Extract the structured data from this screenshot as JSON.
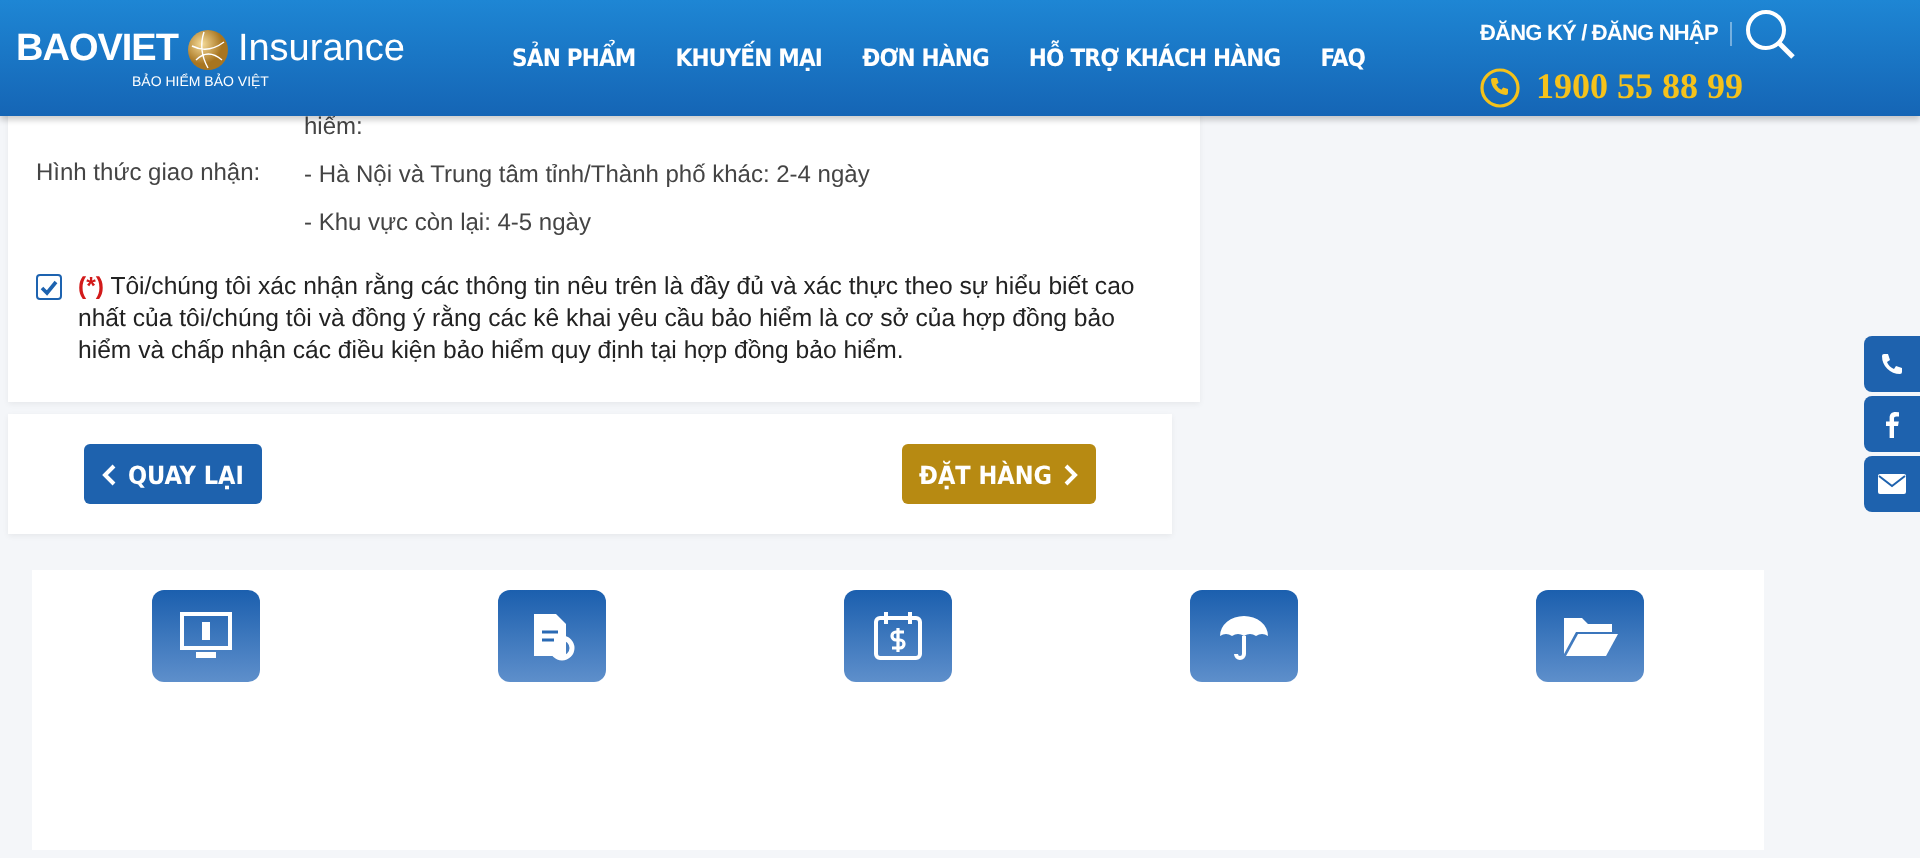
{
  "header": {
    "logo": {
      "brand": "BAOVIET",
      "product": "Insurance",
      "tagline": "BẢO HIỂM BẢO VIỆT"
    },
    "nav": [
      "SẢN PHẨM",
      "KHUYẾN MẠI",
      "ĐƠN HÀNG",
      "HỖ TRỢ KHÁCH HÀNG",
      "FAQ"
    ],
    "account": "ĐĂNG KÝ / ĐĂNG NHẬP",
    "hotline": "1900 55 88 99"
  },
  "delivery": {
    "value_top": "hiểm:",
    "label": "Hình thức giao nhận:",
    "lines": [
      "- Hà Nội và Trung tâm tỉnh/Thành phố khác: 2-4 ngày",
      "- Khu vực còn lại: 4-5 ngày"
    ]
  },
  "confirmation": {
    "checked": true,
    "required_mark": "(*)",
    "text": "Tôi/chúng tôi xác nhận rằng các thông tin nêu trên là đầy đủ và xác thực theo sự hiểu biết cao nhất của tôi/chúng tôi và đồng ý rằng các kê khai yêu cầu bảo hiểm là cơ sở của hợp đồng bảo hiểm và chấp nhận các điều kiện bảo hiểm quy định tại hợp đồng bảo hiểm."
  },
  "actions": {
    "back": "QUAY LẠI",
    "order": "ĐẶT HÀNG"
  },
  "features": [
    {
      "kind": "info"
    },
    {
      "kind": "document"
    },
    {
      "kind": "calendar"
    },
    {
      "kind": "umbrella"
    },
    {
      "kind": "folder"
    }
  ],
  "side_buttons": [
    {
      "kind": "phone"
    },
    {
      "kind": "facebook"
    },
    {
      "kind": "mail"
    }
  ]
}
